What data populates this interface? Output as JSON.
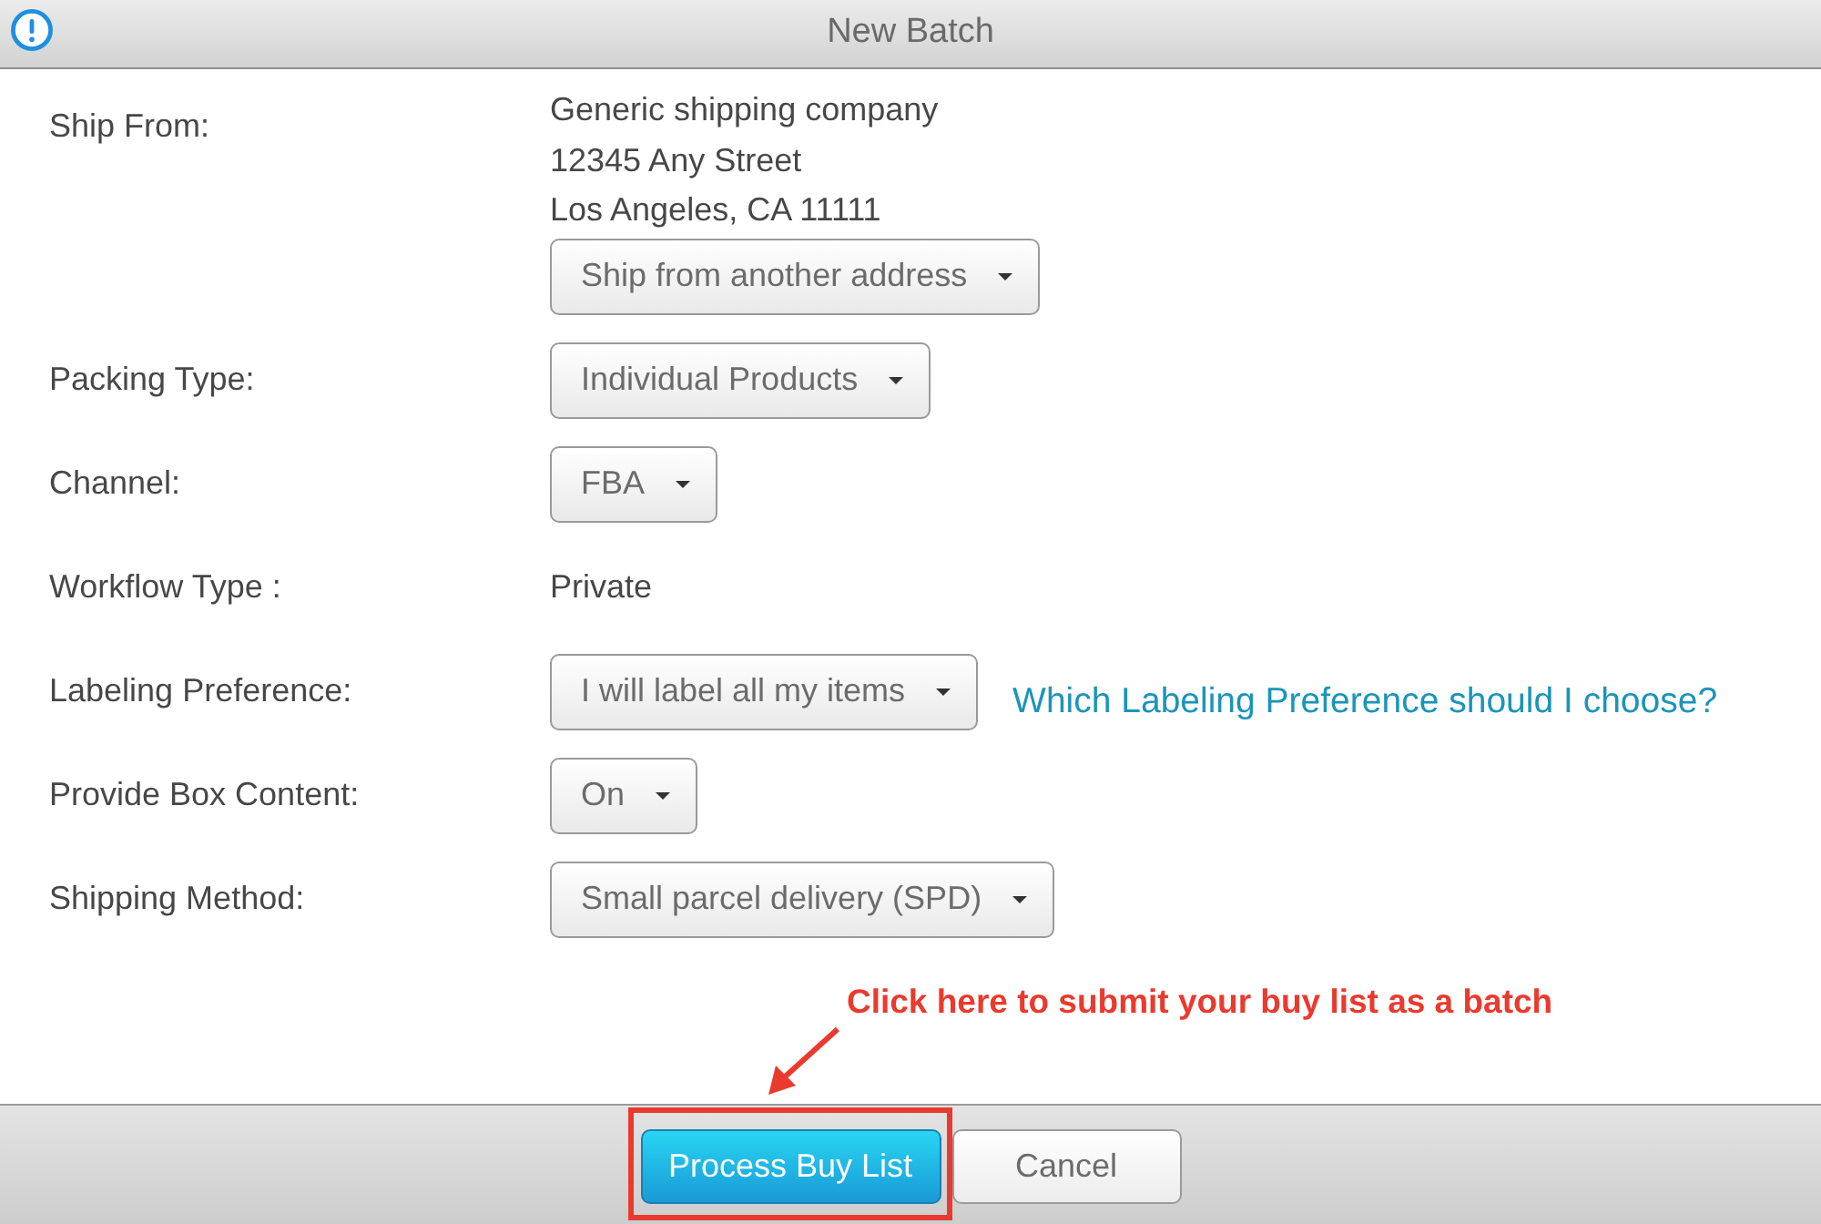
{
  "window": {
    "title": "New Batch"
  },
  "form": {
    "fields": [
      {
        "kind": "address",
        "label": "Ship From:",
        "lines": [
          "Generic shipping company",
          "12345 Any Street",
          "Los Angeles, CA 11111"
        ],
        "value": "Ship from another address"
      },
      {
        "kind": "dropdown",
        "label": "Packing Type:",
        "value": "Individual Products"
      },
      {
        "kind": "dropdown",
        "label": "Channel:",
        "value": "FBA"
      },
      {
        "kind": "text",
        "label": "Workflow Type :",
        "value": "Private"
      },
      {
        "kind": "dropdown",
        "label": "Labeling Preference:",
        "value": "I will label all my items",
        "link": "Which Labeling Preference should I choose?"
      },
      {
        "kind": "dropdown",
        "label": "Provide Box Content:",
        "value": "On"
      },
      {
        "kind": "dropdown",
        "label": "Shipping Method:",
        "value": "Small parcel delivery (SPD)"
      }
    ]
  },
  "annotation": {
    "text": "Click here to submit your buy list as a batch"
  },
  "buttons": [
    {
      "kind": "primary",
      "label": "Process Buy List"
    },
    {
      "kind": "secondary",
      "label": "Cancel"
    }
  ]
}
